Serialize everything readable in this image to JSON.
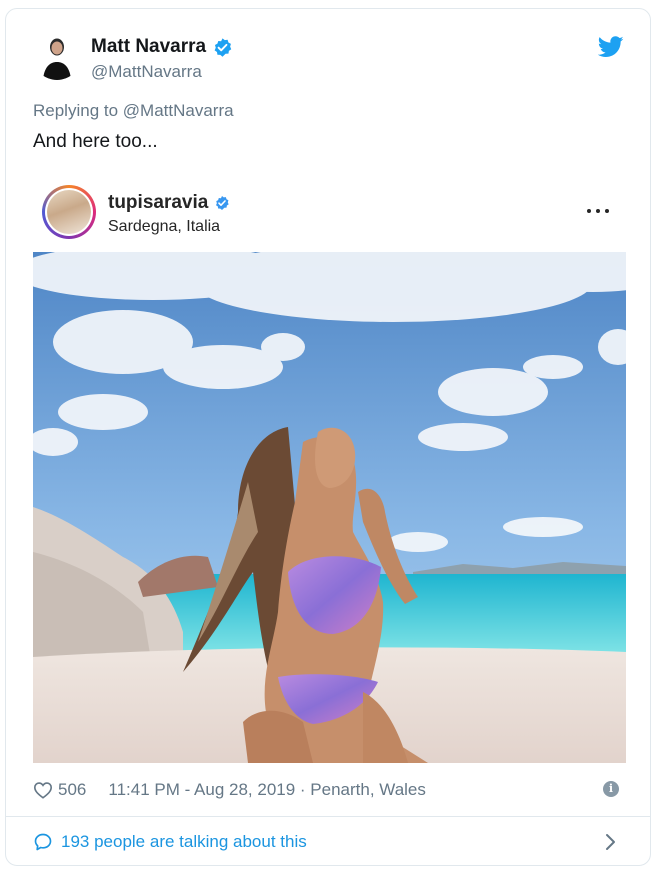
{
  "author": {
    "display_name": "Matt Navarra",
    "handle": "@MattNavarra",
    "verified": true
  },
  "reply": {
    "prefix": "Replying to ",
    "target": "@MattNavarra"
  },
  "tweet": {
    "text": "And here too..."
  },
  "embed": {
    "username": "tupisaravia",
    "verified": true,
    "location": "Sardegna, Italia"
  },
  "footer": {
    "likes": "506",
    "timestamp": "11:41 PM - Aug 28, 2019 · Penarth, Wales"
  },
  "conversation": {
    "label": "193 people are talking about this"
  },
  "icons": {
    "twitter_logo": "twitter-bird-icon",
    "verified": "verified-badge-icon",
    "more": "more-horizontal-icon",
    "like": "heart-icon",
    "info": "info-icon",
    "reply": "chat-bubble-icon",
    "chevron": "chevron-right-icon"
  },
  "colors": {
    "twitter_blue": "#1da1f2",
    "link_blue": "#1b95e0",
    "secondary_text": "#657786",
    "ig_verified": "#3897f0"
  }
}
